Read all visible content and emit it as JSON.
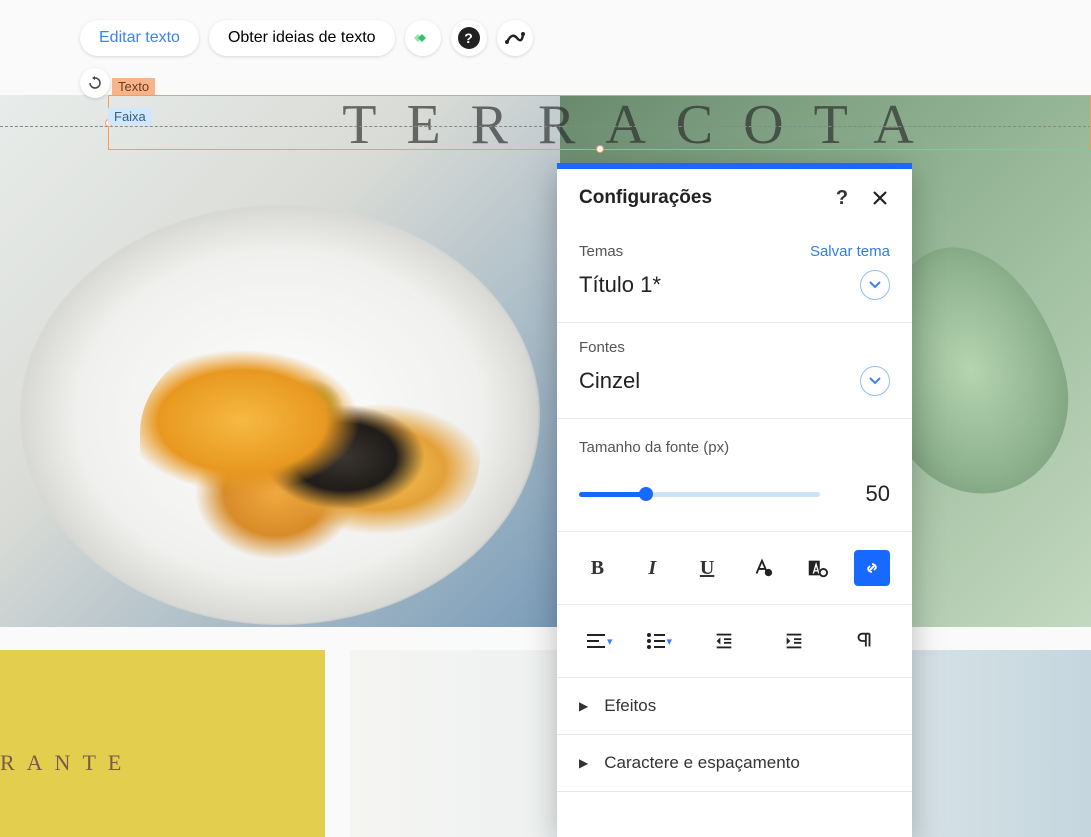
{
  "toolbar": {
    "edit_text": "Editar texto",
    "get_ideas": "Obter ideias de texto"
  },
  "labels": {
    "texto": "Texto",
    "faixa": "Faixa"
  },
  "canvas": {
    "title_text": "TERRACOTA",
    "bottom_text": "RANTE"
  },
  "panel": {
    "title": "Configurações",
    "themes": {
      "label": "Temas",
      "save": "Salvar tema",
      "value": "Título 1*"
    },
    "fonts": {
      "label": "Fontes",
      "value": "Cinzel"
    },
    "font_size": {
      "label": "Tamanho da fonte (px)",
      "value": "50"
    },
    "accordion": {
      "effects": "Efeitos",
      "char_spacing": "Caractere e espaçamento"
    }
  }
}
